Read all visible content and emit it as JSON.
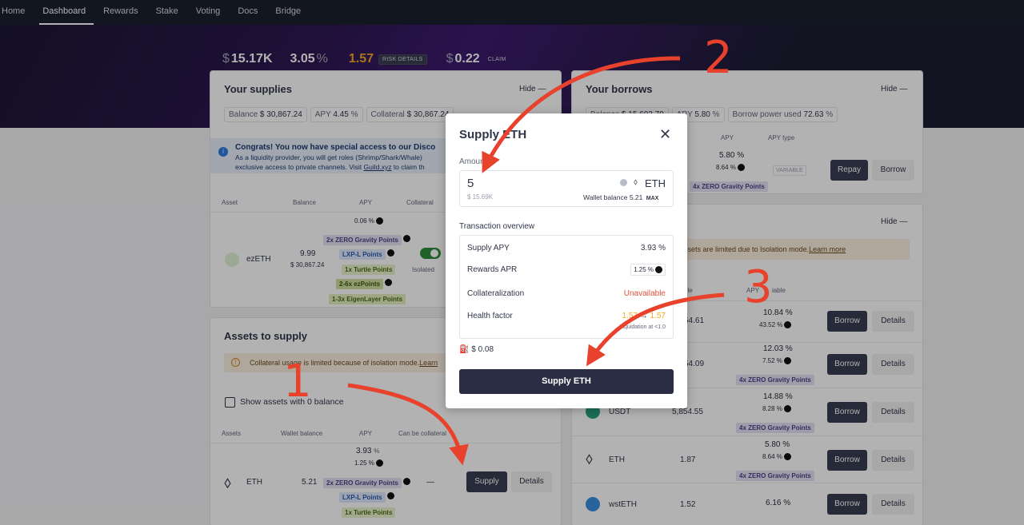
{
  "nav": {
    "items": [
      "Home",
      "Dashboard",
      "Rewards",
      "Stake",
      "Voting",
      "Docs",
      "Bridge"
    ],
    "active": "Dashboard"
  },
  "stats": {
    "net_worth": "15.17K",
    "net_apy": "3.05",
    "health": "1.57",
    "risk_details": "RISK DETAILS",
    "rewards": "0.22",
    "claim": "CLAIM"
  },
  "supplies": {
    "title": "Your supplies",
    "hide": "Hide",
    "balance_label": "Balance",
    "balance": "30,867.24",
    "apy_label": "APY",
    "apy": "4.45",
    "collateral_label": "Collateral",
    "collateral": "30,867.24",
    "notice_title": "Congrats! You now have special access to our Disco",
    "notice_line1": "As a liquidity provider, you will get roles (Shrimp/Shark/Whale)",
    "notice_line2_pre": "exclusive access to private channels. Visit ",
    "notice_link": "Guild.xyz",
    "notice_line2_post": " to claim th",
    "headers": {
      "asset": "Asset",
      "balance": "Balance",
      "apy": "APY",
      "collateral": "Collateral"
    },
    "row": {
      "asset": "ezETH",
      "balance": "9.99",
      "usd": "$ 30,867.24",
      "apy": "0.06 %",
      "isolated": "Isolated",
      "tags": [
        "2x ZERO Gravity Points",
        "LXP-L Points",
        "1x Turtle Points",
        "2-6x ezPoints",
        "1-3x EigenLayer Points"
      ]
    }
  },
  "assets_to_supply": {
    "title": "Assets to supply",
    "warning": "Collateral usage is limited because of isolation mode.",
    "learn": "Learn",
    "show_zero": "Show assets with 0 balance",
    "headers": {
      "assets": "Assets",
      "wallet": "Wallet balance",
      "apy": "APY",
      "collateral": "Can be collateral"
    },
    "row": {
      "asset": "ETH",
      "wallet": "5.21",
      "apy": "3.93",
      "sub_apy": "1.25 %",
      "collateral": "—",
      "tags": [
        "2x ZERO Gravity Points",
        "LXP-L Points",
        "1x Turtle Points"
      ],
      "supply": "Supply",
      "details": "Details"
    }
  },
  "borrows": {
    "title": "Your borrows",
    "hide": "Hide",
    "balance_label": "Balance",
    "balance": "15,603.79",
    "apy_label": "APY",
    "apy": "5.80",
    "power_label": "Borrow power used",
    "power": "72.63",
    "headers": {
      "apy": "APY",
      "apy_type": "APY type"
    },
    "row": {
      "apy": "5.80 %",
      "sub_apy": "8.64 %",
      "variable": "VARIABLE",
      "tag": "4x ZERO Gravity Points",
      "repay": "Repay",
      "borrow": "Borrow"
    }
  },
  "assets_to_borrow": {
    "hide": "Hide",
    "notice": "ssets are limited due to Isolation mode.",
    "learn": "Learn more",
    "headers": {
      "available": "ble",
      "apy": "APY",
      "variable": "iable"
    },
    "rows": [
      {
        "asset": "",
        "available": "54.61",
        "apy": "10.84 %",
        "sub": "43.52 %",
        "tag": "",
        "borrow": "Borrow",
        "details": "Details"
      },
      {
        "asset": "",
        "available": "54.09",
        "apy": "12.03 %",
        "sub": "7.52 %",
        "tag": "4x ZERO Gravity Points",
        "borrow": "Borrow",
        "details": "Details"
      },
      {
        "asset": "USDT",
        "available": "5,854.55",
        "apy": "14.88 %",
        "sub": "8.28 %",
        "tag": "4x ZERO Gravity Points",
        "borrow": "Borrow",
        "details": "Details"
      },
      {
        "asset": "ETH",
        "available": "1.87",
        "apy": "5.80 %",
        "sub": "8.64 %",
        "tag": "4x ZERO Gravity Points",
        "borrow": "Borrow",
        "details": "Details"
      },
      {
        "asset": "wstETH",
        "available": "1.52",
        "apy": "6.16 %",
        "sub": "",
        "tag": "",
        "borrow": "Borrow",
        "details": "Details"
      }
    ]
  },
  "modal": {
    "title": "Supply ETH",
    "amount_label": "Amount",
    "amount_value": "5",
    "token": "ETH",
    "usd_value": "$ 15.69K",
    "wallet_balance_label": "Wallet balance",
    "wallet_balance": "5.21",
    "max": "MAX",
    "overview_label": "Transaction overview",
    "supply_apy_label": "Supply APY",
    "supply_apy": "3.93 %",
    "rewards_apr_label": "Rewards APR",
    "rewards_apr": "1.25 %",
    "collateralization_label": "Collateralization",
    "collateralization": "Unavailable",
    "health_label": "Health factor",
    "health_from": "1.57",
    "health_to": "1.57",
    "liquidation": "Liquidation at <1.0",
    "gas": "$ 0.08",
    "submit": "Supply ETH"
  },
  "annotations": [
    "1",
    "2",
    "3"
  ],
  "colors": {
    "accent": "#2b2d45",
    "annotation": "#e8412c",
    "gold": "#f6a823",
    "warning": "#e0533b"
  }
}
